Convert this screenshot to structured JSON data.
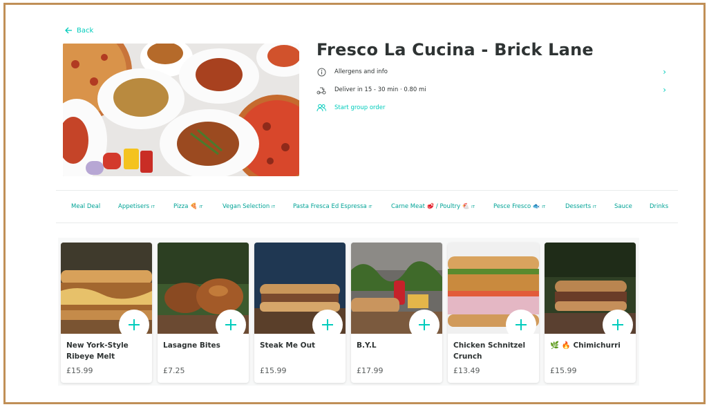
{
  "nav": {
    "back_label": "Back"
  },
  "restaurant": {
    "name": "Fresco La Cucina - Brick Lane",
    "allergens_label": "Allergens and info",
    "delivery_label": "Deliver in 15 - 30 min · 0.80 mi",
    "group_order_label": "Start group order"
  },
  "categories": [
    {
      "label": "Meal Deal",
      "tag": ""
    },
    {
      "label": "Appetisers",
      "tag": "IT"
    },
    {
      "label": "Pizza 🍕",
      "tag": "IT"
    },
    {
      "label": "Vegan Selection",
      "tag": "IT"
    },
    {
      "label": "Pasta Fresca Ed Espressa",
      "tag": "IT"
    },
    {
      "label": "Carne Meat 🥩 / Poultry 🐔",
      "tag": "IT"
    },
    {
      "label": "Pesce Fresco 🐟",
      "tag": "IT"
    },
    {
      "label": "Desserts",
      "tag": "IT"
    },
    {
      "label": "Sauce",
      "tag": ""
    },
    {
      "label": "Drinks",
      "tag": ""
    }
  ],
  "items": [
    {
      "name": "New York-Style Ribeye Melt",
      "price": "£15.99"
    },
    {
      "name": "Lasagne Bites",
      "price": "£7.25"
    },
    {
      "name": "Steak Me Out",
      "price": "£15.99"
    },
    {
      "name": "B.Y.L",
      "price": "£17.99"
    },
    {
      "name": "Chicken Schnitzel Crunch",
      "price": "£13.49"
    },
    {
      "name": "🌿 🔥 Chimichurri",
      "price": "£15.99"
    }
  ],
  "colors": {
    "accent": "#00ccbc",
    "frame": "#c08f56",
    "text": "#2e3333"
  }
}
